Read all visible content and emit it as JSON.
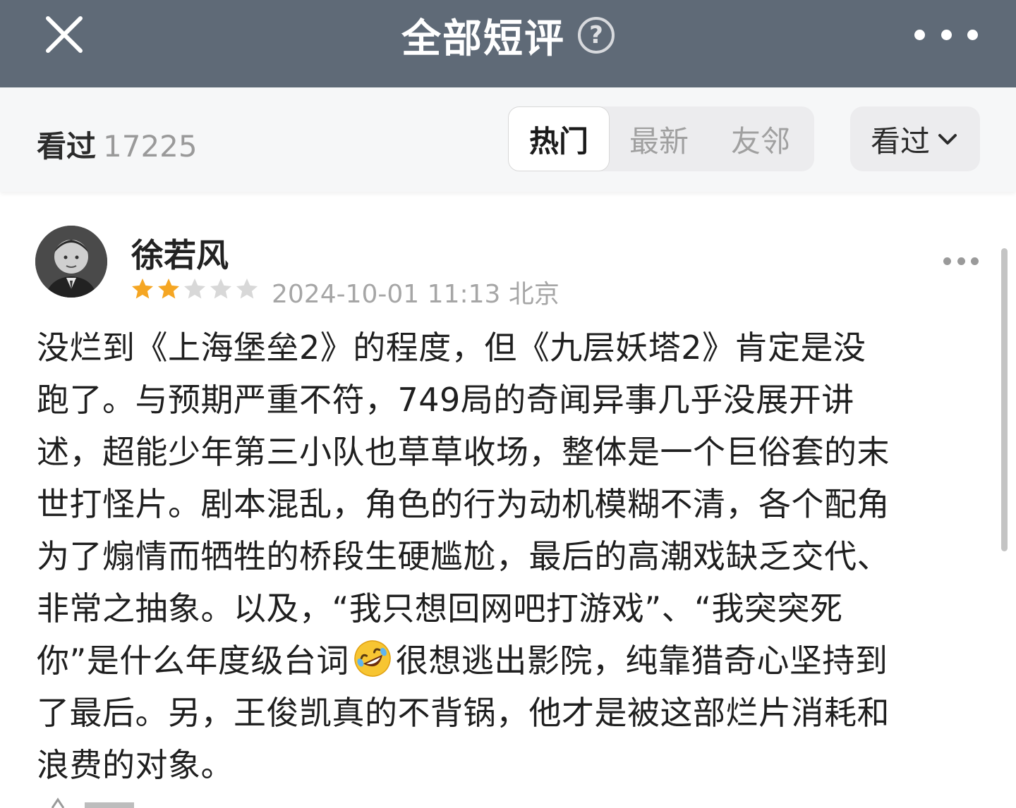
{
  "header": {
    "close_icon": "close-icon",
    "title": "全部短评",
    "help_icon": "?",
    "more_icon": "more-horizontal-icon",
    "background": "#5f6a77"
  },
  "filter": {
    "count_label": "看过",
    "count_value": "17225",
    "tabs": [
      {
        "label": "热门",
        "active": true
      },
      {
        "label": "最新",
        "active": false
      },
      {
        "label": "友邻",
        "active": false
      }
    ],
    "dropdown_label": "看过",
    "dropdown_icon": "chevron-down-icon"
  },
  "review": {
    "username": "徐若风",
    "rating": 2,
    "max_rating": 5,
    "star_color": "#f5a623",
    "star_empty_color": "#d8d8d8",
    "date": "2024-10-01 11:13",
    "location": "北京",
    "lines": [
      "没烂到《上海堡垒2》的程度，但《九层妖塔2》肯定是没",
      "跑了。与预期严重不符，749局的奇闻异事几乎没展开讲",
      "述，超能少年第三小队也草草收场，整体是一个巨俗套的末",
      "世打怪片。剧本混乱，角色的行为动机模糊不清，各个配角",
      "为了煽情而牺牲的桥段生硬尴尬，最后的高潮戏缺乏交代、",
      "非常之抽象。以及，“我只想回网吧打游戏”、“我突突死"
    ],
    "line7_before_emoji": "你”是什么年度级台词",
    "emoji_icon": "rolling-on-floor-laughing-emoji",
    "line7_after_emoji": "很想逃出影院，纯靠猎奇心坚持到",
    "line8": "了最后。另，王俊凯真的不背锅，他才是被这部烂片消耗和",
    "line9": "浪费的对象。"
  }
}
